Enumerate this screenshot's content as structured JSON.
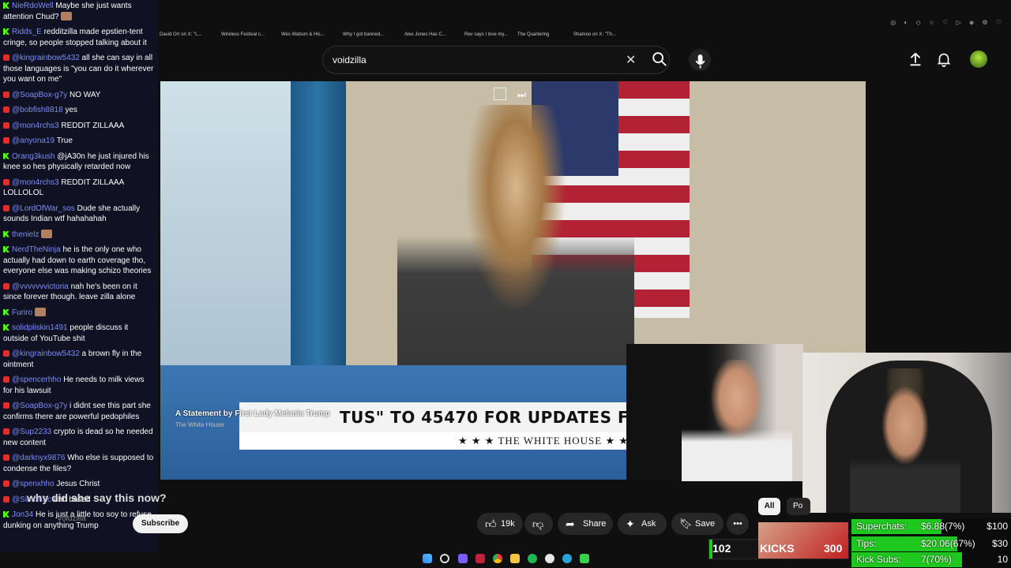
{
  "chat": {
    "messages": [
      {
        "platform": "kick",
        "user": "NieRdoWell",
        "text": "Maybe she just wants attention Chud?",
        "emote": true
      },
      {
        "platform": "kick",
        "user": "Ridds_E",
        "text": "redditzilla made epstien-tent cringe, so people stopped talking about it"
      },
      {
        "platform": "youtube",
        "user": "@kingrainbow5432",
        "text": "all she can say in all those languages is \"you can do it wherever you want on me\""
      },
      {
        "platform": "youtube",
        "user": "@SoapBox-g7y",
        "text": "NO WAY"
      },
      {
        "platform": "youtube",
        "user": "@bobfish8818",
        "text": "yes"
      },
      {
        "platform": "youtube",
        "user": "@mon4rchs3",
        "text": "REDDIT ZILLAAA"
      },
      {
        "platform": "youtube",
        "user": "@anyona19",
        "text": "True"
      },
      {
        "platform": "kick",
        "user": "Orang3kush",
        "text": "@jA30n he just injured his knee so hes physically retarded now"
      },
      {
        "platform": "youtube",
        "user": "@mon4rchs3",
        "text": "REDDIT ZILLAAA LOLLOLOL"
      },
      {
        "platform": "youtube",
        "user": "@LordOfWar_sos",
        "text": "Dude she actually sounds Indian wtf hahahahah"
      },
      {
        "platform": "kick",
        "user": "thenielz",
        "text": "",
        "emote": true
      },
      {
        "platform": "kick",
        "user": "NerdTheNinja",
        "text": "he is the only one who actually had down to earth coverage tho, everyone else was making schizo theories"
      },
      {
        "platform": "youtube",
        "user": "@vvvvvvvictoria",
        "text": "nah he's been on it since forever though. leave zilla alone"
      },
      {
        "platform": "kick",
        "user": "Furiro",
        "text": "",
        "emote": true
      },
      {
        "platform": "kick",
        "user": "solidpliskin1491",
        "text": "people discuss it outside of YouTube shit"
      },
      {
        "platform": "youtube",
        "user": "@kingrainbow5432",
        "text": "a brown fly in the ointment"
      },
      {
        "platform": "youtube",
        "user": "@spencerhho",
        "text": "He needs to milk views for his lawsuit"
      },
      {
        "platform": "youtube",
        "user": "@SoapBox-g7y",
        "text": "i didnt see this part she confirms there are powerful pedophiles"
      },
      {
        "platform": "youtube",
        "user": "@Sup2233",
        "text": "crypto is dead so he needed new content"
      },
      {
        "platform": "youtube",
        "user": "@darknyx9876",
        "text": "Who else is supposed to condense the files?"
      },
      {
        "platform": "youtube",
        "user": "@spenxhho",
        "text": "Jesus Christ"
      },
      {
        "platform": "youtube",
        "user": "@SimonSc",
        "text": "uhh based"
      },
      {
        "platform": "kick",
        "user": "Jon34",
        "text": "He is just a little too soy to refuse dunking on anything Trump"
      }
    ]
  },
  "browser": {
    "bookmarks": [
      "David Orr on X: \"L...",
      "Wireless Festival c...",
      "Wes Watson & His...",
      "Why I got banned...",
      "Alex Jones Has C...",
      "Rev says I love my...",
      "The Quartering",
      "Shamoo on X: \"Th..."
    ]
  },
  "search": {
    "value": "voidzilla"
  },
  "video": {
    "overlay_title": "A Statement by First Lady Melania Trump",
    "overlay_subtitle": "The White House",
    "ticker": "TUS\" TO 45470 FOR UPDATES FRO",
    "banner": "★ ★ ★   THE WHITE HOUSE   ★ ★ ★"
  },
  "meta": {
    "title": "why did she say this now?",
    "channel": "Voidzilla",
    "subscribe_label": "Subscribe",
    "likes": "19k",
    "share_label": "Share",
    "ask_label": "Ask",
    "save_label": "Save",
    "chips": [
      "All",
      "Po"
    ]
  },
  "stream_stats": {
    "viewers": "102",
    "kicks_label": "KICKS",
    "kicks_count": "300",
    "goals": [
      {
        "label": "Superchats:",
        "value": "$6.88(7%)",
        "goal": "$100",
        "progress": 0.07
      },
      {
        "label": "Tips:",
        "value": "$20.06(67%)",
        "goal": "$30",
        "progress": 0.67
      },
      {
        "label": "Kick Subs:",
        "value": "7(70%)",
        "goal": "10",
        "progress": 0.7
      }
    ]
  },
  "colors": {
    "accent": "#1ec81e",
    "youtube_red": "#e52d27",
    "kick_green": "#53fc18"
  }
}
